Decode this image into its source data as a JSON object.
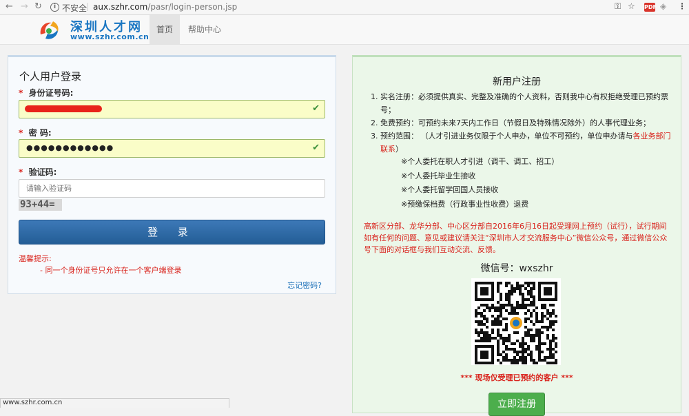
{
  "browser": {
    "insecure_label": "不安全",
    "url_host": "aux.szhr.com",
    "url_path": "/pasr/login-person.jsp"
  },
  "header": {
    "logo_cn": "深圳人才网",
    "logo_en": "www.szhr.com.cn",
    "nav_home": "首页",
    "nav_help": "帮助中心"
  },
  "login": {
    "title": "个人用户登录",
    "required_mark": "*",
    "id_label": "身份证号码:",
    "password_label": "密  码:",
    "password_value": "●●●●●●●●●●●●",
    "captcha_label": "验证码:",
    "captcha_placeholder": "请输入验证码",
    "captcha_text": "93+44=",
    "login_button": "登 录",
    "tips_title": "温馨提示:",
    "tips_line": "- 同一个身份证号只允许在一个客户端登录",
    "forgot_password": "忘记密码?"
  },
  "register": {
    "title": "新用户注册",
    "items": [
      {
        "num": "1.",
        "text": "实名注册：必须提供真实、完整及准确的个人资料，否则我中心有权拒绝受理已预约票号；"
      },
      {
        "num": "2.",
        "text": "免费预约：可预约未来7天内工作日（节假日及特殊情况除外）的人事代理业务；"
      },
      {
        "num": "3.",
        "text": "预约范围：  （人才引进业务仅限于个人申办，单位不可预约，单位申办请与",
        "link": "各业务部门联系",
        "text_after": "）"
      }
    ],
    "sub_items": [
      "※个人委托在职人才引进（调干、调工、招工）",
      "※个人委托毕业生接收",
      "※个人委托留学回国人员接收",
      "※预缴保档费（行政事业性收费）退费"
    ],
    "notice": "高新区分部、龙华分部、中心区分部自2016年6月16日起受理网上预约（试行），试行期间如有任何的问题、意见或建议请关注“深圳市人才交流服务中心”微信公众号，通过微信公众号下面的对话框与我们互动交流、反馈。",
    "wechat_label": "微信号：wxszhr",
    "qr_note": "*** 现场仅受理已预约的客户 ***",
    "register_button": "立即注册"
  },
  "status_bar": {
    "text": "www.szhr.com.cn"
  },
  "colors": {
    "accent_blue": "#235d96",
    "warning_red": "#d9231c",
    "success_green": "#4cae4c"
  }
}
